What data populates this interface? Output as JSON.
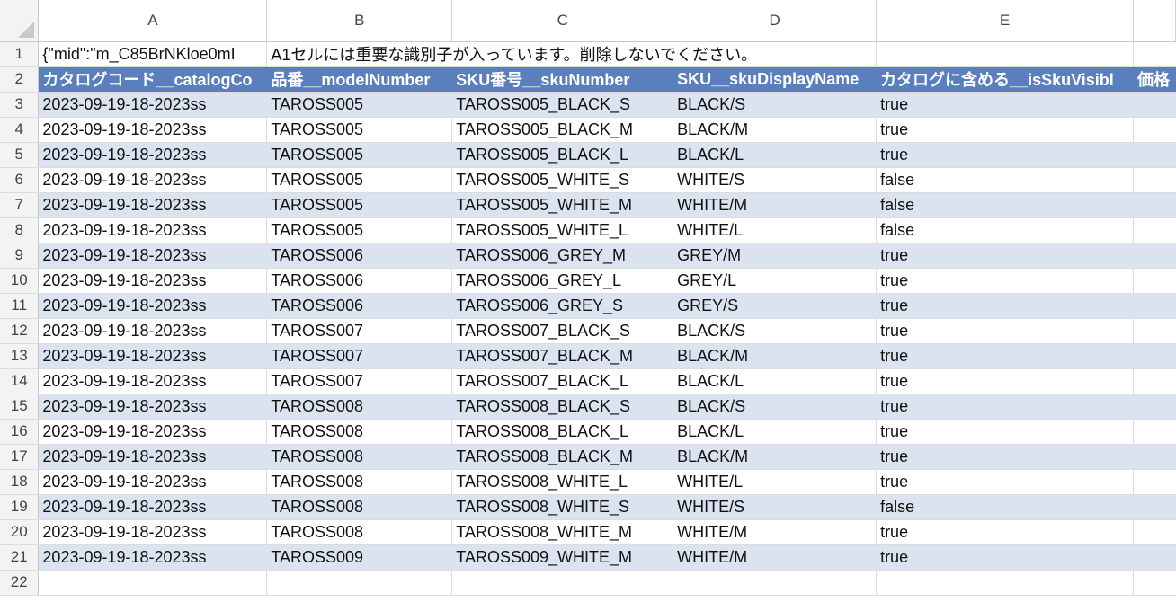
{
  "columns": [
    "A",
    "B",
    "C",
    "D",
    "E"
  ],
  "row1": {
    "a": "{\"mid\":\"m_C85BrNKloe0mI",
    "b": "A1セルには重要な識別子が入っています。削除しないでください。"
  },
  "header": {
    "a": "カタログコード__catalogCo",
    "b": "品番__modelNumber",
    "c": "SKU番号__skuNumber",
    "d": "SKU__skuDisplayName",
    "e": "カタログに含める__isSkuVisibl",
    "f": "価格"
  },
  "rows": [
    {
      "n": "3",
      "a": "2023-09-19-18-2023ss",
      "b": "TAROSS005",
      "c": "TAROSS005_BLACK_S",
      "d": "BLACK/S",
      "e": "true"
    },
    {
      "n": "4",
      "a": "2023-09-19-18-2023ss",
      "b": "TAROSS005",
      "c": "TAROSS005_BLACK_M",
      "d": "BLACK/M",
      "e": "true"
    },
    {
      "n": "5",
      "a": "2023-09-19-18-2023ss",
      "b": "TAROSS005",
      "c": "TAROSS005_BLACK_L",
      "d": "BLACK/L",
      "e": "true"
    },
    {
      "n": "6",
      "a": "2023-09-19-18-2023ss",
      "b": "TAROSS005",
      "c": "TAROSS005_WHITE_S",
      "d": "WHITE/S",
      "e": "false"
    },
    {
      "n": "7",
      "a": "2023-09-19-18-2023ss",
      "b": "TAROSS005",
      "c": "TAROSS005_WHITE_M",
      "d": "WHITE/M",
      "e": "false"
    },
    {
      "n": "8",
      "a": "2023-09-19-18-2023ss",
      "b": "TAROSS005",
      "c": "TAROSS005_WHITE_L",
      "d": "WHITE/L",
      "e": "false"
    },
    {
      "n": "9",
      "a": "2023-09-19-18-2023ss",
      "b": "TAROSS006",
      "c": "TAROSS006_GREY_M",
      "d": "GREY/M",
      "e": "true"
    },
    {
      "n": "10",
      "a": "2023-09-19-18-2023ss",
      "b": "TAROSS006",
      "c": "TAROSS006_GREY_L",
      "d": "GREY/L",
      "e": "true"
    },
    {
      "n": "11",
      "a": "2023-09-19-18-2023ss",
      "b": "TAROSS006",
      "c": "TAROSS006_GREY_S",
      "d": "GREY/S",
      "e": "true"
    },
    {
      "n": "12",
      "a": "2023-09-19-18-2023ss",
      "b": "TAROSS007",
      "c": "TAROSS007_BLACK_S",
      "d": "BLACK/S",
      "e": "true"
    },
    {
      "n": "13",
      "a": "2023-09-19-18-2023ss",
      "b": "TAROSS007",
      "c": "TAROSS007_BLACK_M",
      "d": "BLACK/M",
      "e": "true"
    },
    {
      "n": "14",
      "a": "2023-09-19-18-2023ss",
      "b": "TAROSS007",
      "c": "TAROSS007_BLACK_L",
      "d": "BLACK/L",
      "e": "true"
    },
    {
      "n": "15",
      "a": "2023-09-19-18-2023ss",
      "b": "TAROSS008",
      "c": "TAROSS008_BLACK_S",
      "d": "BLACK/S",
      "e": "true"
    },
    {
      "n": "16",
      "a": "2023-09-19-18-2023ss",
      "b": "TAROSS008",
      "c": "TAROSS008_BLACK_L",
      "d": "BLACK/L",
      "e": "true"
    },
    {
      "n": "17",
      "a": "2023-09-19-18-2023ss",
      "b": "TAROSS008",
      "c": "TAROSS008_BLACK_M",
      "d": "BLACK/M",
      "e": "true"
    },
    {
      "n": "18",
      "a": "2023-09-19-18-2023ss",
      "b": "TAROSS008",
      "c": "TAROSS008_WHITE_L",
      "d": "WHITE/L",
      "e": "true"
    },
    {
      "n": "19",
      "a": "2023-09-19-18-2023ss",
      "b": "TAROSS008",
      "c": "TAROSS008_WHITE_S",
      "d": "WHITE/S",
      "e": "false"
    },
    {
      "n": "20",
      "a": "2023-09-19-18-2023ss",
      "b": "TAROSS008",
      "c": "TAROSS008_WHITE_M",
      "d": "WHITE/M",
      "e": "true"
    },
    {
      "n": "21",
      "a": "2023-09-19-18-2023ss",
      "b": "TAROSS009",
      "c": "TAROSS009_WHITE_M",
      "d": "WHITE/M",
      "e": "true"
    }
  ],
  "row_labels": {
    "r1": "1",
    "r2": "2",
    "r22": "22"
  },
  "colors": {
    "header_fill": "#5b7fbd",
    "band_fill": "#dbe3f1"
  }
}
